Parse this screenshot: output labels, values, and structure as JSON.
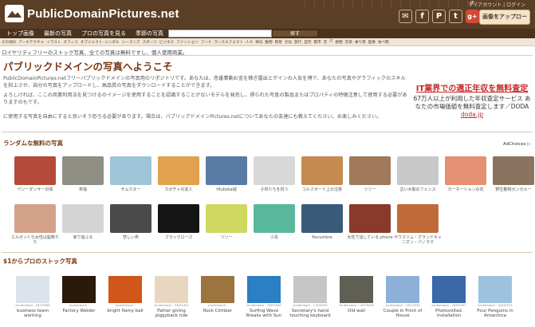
{
  "header": {
    "logo_text": "PublicDomainPictures.net",
    "languages": [
      "",
      "",
      "",
      "",
      "",
      "",
      "",
      "",
      "",
      "",
      "",
      "",
      "",
      "",
      "",
      "",
      "",
      "JP",
      "",
      "",
      ""
    ],
    "account_links": "マイアカウント | ログイン",
    "social": [
      {
        "name": "email-share",
        "glyph": "✉"
      },
      {
        "name": "facebook",
        "glyph": "f"
      },
      {
        "name": "pinterest",
        "glyph": "P"
      },
      {
        "name": "twitter",
        "glyph": "t"
      },
      {
        "name": "google-plus",
        "glyph": "g+"
      }
    ],
    "upload_label": "画像をアップロード"
  },
  "nav": {
    "items": [
      "トップ画像",
      "最新の写真",
      "プロの写真を見る",
      "季節の写真"
    ],
    "search_placeholder": "",
    "search_button": "探す"
  },
  "categories": [
    "その他の",
    "アーキテクチャ",
    "イラスト",
    "オフィス",
    "オブジェクト",
    "シンボル",
    "シーズンズ",
    "スポーツ",
    "ビジネス",
    "ファッション",
    "フード",
    "ラースエフェクト",
    "人々",
    "休日",
    "動物",
    "教育",
    "文化",
    "旅行",
    "自然",
    "都市",
    "音",
    "IT",
    "植物",
    "音楽",
    "乗り物",
    "医療",
    "食べ物"
  ],
  "tagline": "ロイヤリティフリーのストック写真、全ての写真は無料ですし、個人使用商業。",
  "welcome_title": "パブリックドメインの写真へようこそ",
  "intro_text": "PublicDomainPictures.netフリーパブリックドメインの写真用のリポジトリです。あなたは、悲番事動お金を稼ぎ露出とゲインの人気を博で、あなたの写真やグラフィックのスキルを抑上させ、自分の写真をアップロードし、高品質の写真をダウンロードすることができます。",
  "p2_text": "よろしければ、ここの商業利用法を見つけるのイメージを使用することを認識することがないモデルを発売し、得られた写真の製品またはプロパティの特徴注意して使用する必要がありますのもです。",
  "p3_text": "に使用する写真を自由にすると良いそう恐ろる必要があります。場合は、パブリックドメインPictures.netについてあなたの友達にも教えてください。お楽しみください。",
  "ad": {
    "title": "IT業界での適正年収を無料査定",
    "body": "67万人以上が利用した年収査定サービス あなたの市場価値を無料査定します／DODA",
    "link": "doda.jp"
  },
  "random_section": {
    "title": "ランダムな無料の写真",
    "adchoices": "AdChoices ▷",
    "row1": [
      {
        "caption": "ベリーダンサーの体",
        "color": "#b54a3a"
      },
      {
        "caption": "単独",
        "color": "#8f8f86"
      },
      {
        "caption": "サムカヌー",
        "color": "#9ec4d8"
      },
      {
        "caption": "カボチャの友人",
        "color": "#e1a14d"
      },
      {
        "caption": "Hluboka城",
        "color": "#5a7ba5"
      },
      {
        "caption": "子供たちを祝う",
        "color": "#d8d8d8"
      },
      {
        "caption": "コルクボード上の注意",
        "color": "#c58a4f"
      },
      {
        "caption": "ツリー",
        "color": "#a07a5a"
      },
      {
        "caption": "古い木製のフェンス",
        "color": "#c8c8c8"
      },
      {
        "caption": "カーネーションの花",
        "color": "#e58f73"
      },
      {
        "caption": "野生動物ガンガルー",
        "color": "#8a7460"
      }
    ],
    "row2": [
      {
        "caption": "エルガントな女性は髪飾りた",
        "color": "#d3a18a"
      },
      {
        "caption": "家で遊ぶる",
        "color": "#d4d4d4"
      },
      {
        "caption": "悲しい男",
        "color": "#4a4a4a"
      },
      {
        "caption": "ブラックローズ",
        "color": "#151515"
      },
      {
        "caption": "リリー",
        "color": "#cfd85f"
      },
      {
        "caption": "小島",
        "color": "#59b89b"
      },
      {
        "caption": "Penumbra",
        "color": "#3a5a7a"
      },
      {
        "caption": "女性で話している phone",
        "color": "#8a3a2a"
      },
      {
        "caption": "サウスリム・グランドキャニオン・パノラマ",
        "color": "#c06a3a"
      }
    ]
  },
  "stock_section": {
    "title": "$1からプロのストック写真",
    "items": [
      {
        "id": "shutterstock - 59379086",
        "title": "business team working",
        "color": "#dde3ea"
      },
      {
        "id": "shutterstock -",
        "title": "Factory Welder",
        "color": "#2a1a0a"
      },
      {
        "id": "shutterstock -",
        "title": "bright flamy ball",
        "color": "#d1561a"
      },
      {
        "id": "shutterstock - 93931490",
        "title": "Father giving piggyback ride",
        "color": "#e8d6c0"
      },
      {
        "id": "shutterstock -",
        "title": "Rock Climber",
        "color": "#9b7440"
      },
      {
        "id": "shutterstock - 25657060",
        "title": "Surfing Wave Breaks with Sun",
        "color": "#2c7fc2"
      },
      {
        "id": "shutterstock - 11930200",
        "title": "Secretary's hand touching keyboard",
        "color": "#c6c6c6"
      },
      {
        "id": "shutterstock - 10976046",
        "title": "Old wall",
        "color": "#5f5f55"
      },
      {
        "id": "shutterstock - 23572026",
        "title": "Couple in Front of House",
        "color": "#8db0d8"
      },
      {
        "id": "shutterstock - 29903497",
        "title": "Photovoltaic installation",
        "color": "#3a68a8"
      },
      {
        "id": "shutterstock - 50497035",
        "title": "Four Penguins in Antarctica",
        "color": "#9cc2e0"
      }
    ]
  }
}
